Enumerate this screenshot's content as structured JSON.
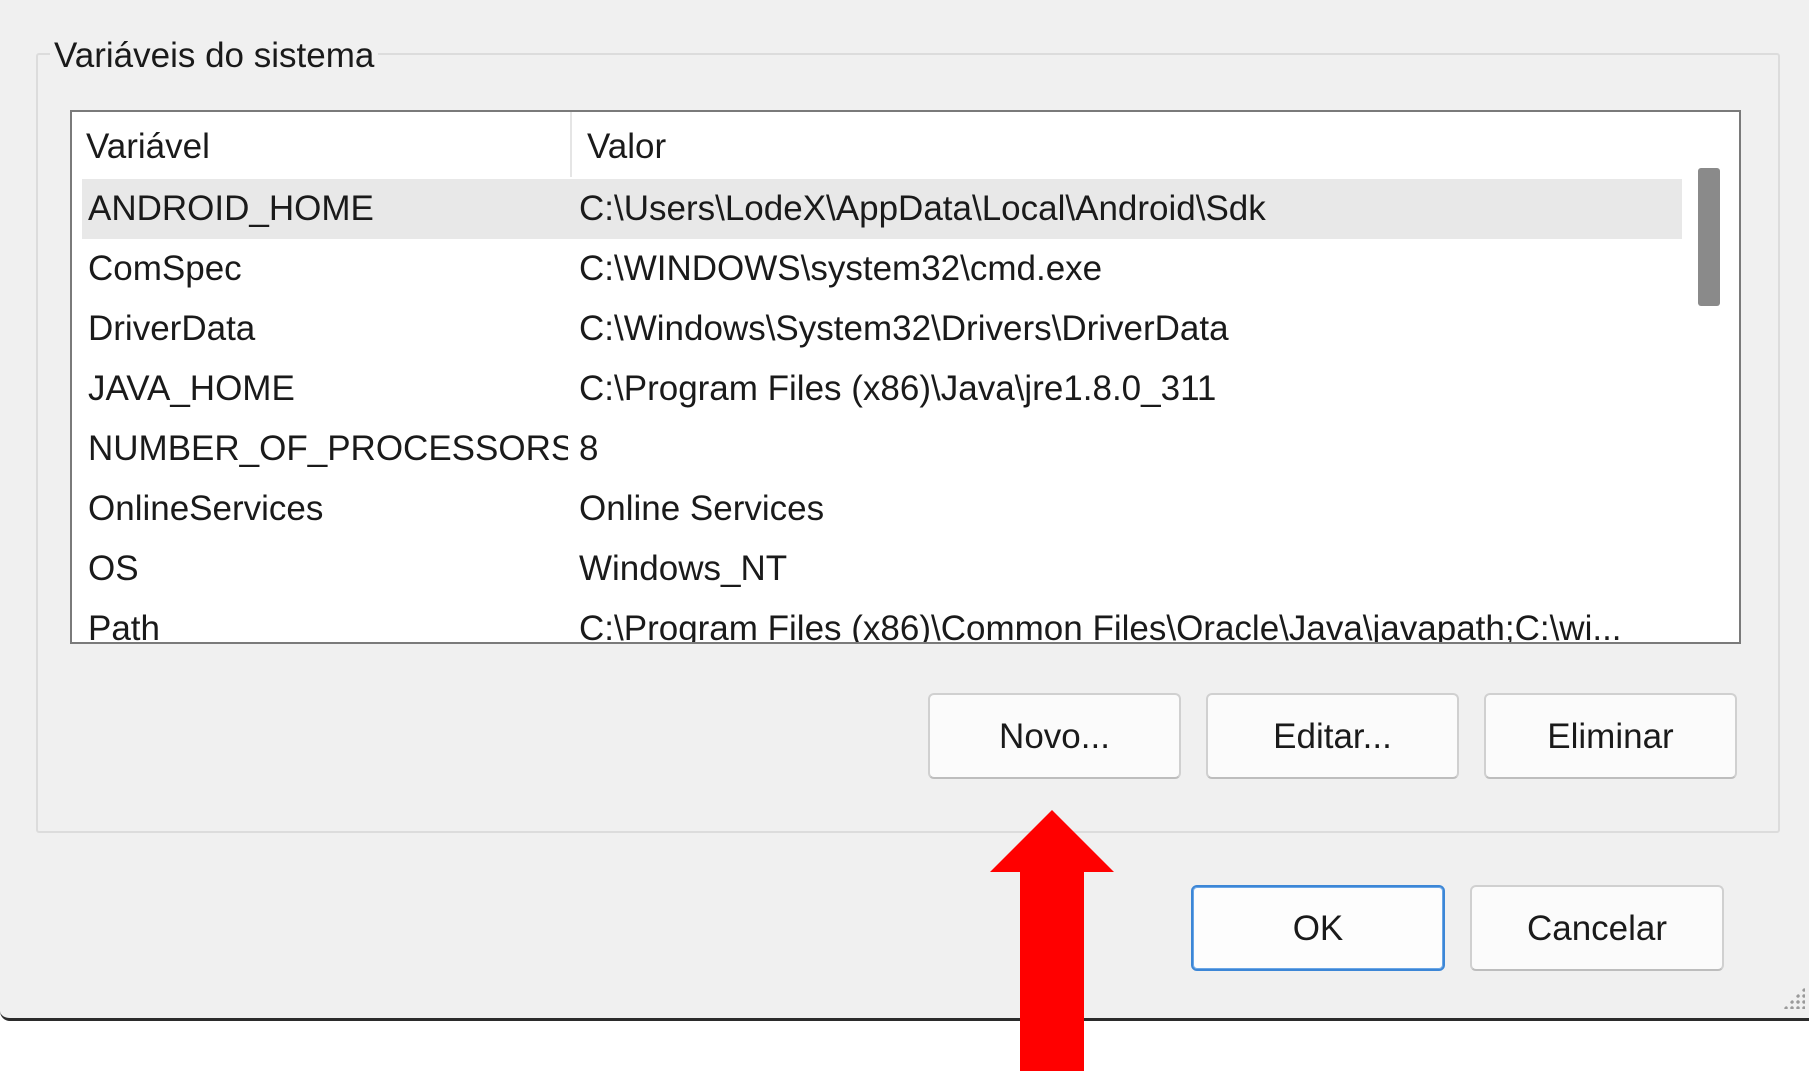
{
  "group": {
    "title": "Variáveis do sistema"
  },
  "table": {
    "columns": [
      "Variável",
      "Valor"
    ],
    "rows": [
      {
        "name": "ANDROID_HOME",
        "value": "C:\\Users\\LodeX\\AppData\\Local\\Android\\Sdk"
      },
      {
        "name": "ComSpec",
        "value": "C:\\WINDOWS\\system32\\cmd.exe"
      },
      {
        "name": "DriverData",
        "value": "C:\\Windows\\System32\\Drivers\\DriverData"
      },
      {
        "name": "JAVA_HOME",
        "value": "C:\\Program Files (x86)\\Java\\jre1.8.0_311"
      },
      {
        "name": "NUMBER_OF_PROCESSORS",
        "value": "8"
      },
      {
        "name": "OnlineServices",
        "value": "Online Services"
      },
      {
        "name": "OS",
        "value": "Windows_NT"
      },
      {
        "name": "Path",
        "value": "C:\\Program Files (x86)\\Common Files\\Oracle\\Java\\javapath;C:\\wi..."
      }
    ]
  },
  "buttons": {
    "new": "Novo...",
    "edit": "Editar...",
    "delete": "Eliminar",
    "ok": "OK",
    "cancel": "Cancelar"
  },
  "colors": {
    "annotation_arrow": "#ff0000",
    "selection": "#e8e8e8",
    "ok_border": "#3c86d6"
  },
  "icons": {
    "annotation": "up-arrow-icon"
  }
}
